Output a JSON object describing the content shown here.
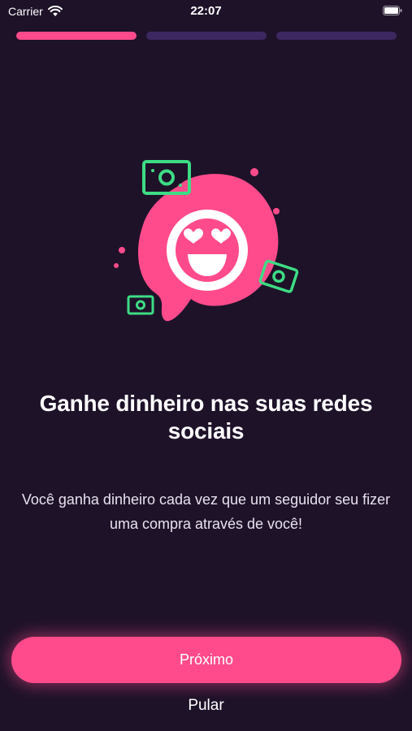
{
  "status_bar": {
    "carrier": "Carrier",
    "time": "22:07",
    "wifi_icon": "wifi-icon",
    "battery_icon": "battery-icon"
  },
  "progress": {
    "total_steps": 3,
    "current_step": 1
  },
  "illustration": {
    "icon": "heart-eyes-emoji-with-money",
    "colors": {
      "blob": "#ff4b8b",
      "money": "#3ddc84",
      "face": "#ffffff"
    }
  },
  "onboarding": {
    "title": "Ganhe dinheiro nas suas redes sociais",
    "description": "Você ganha dinheiro cada vez que um seguidor seu fizer uma compra através de você!"
  },
  "actions": {
    "next_label": "Próximo",
    "skip_label": "Pular"
  },
  "colors": {
    "background": "#1e1229",
    "accent": "#ff4b8b",
    "progress_inactive": "#3d2760"
  }
}
